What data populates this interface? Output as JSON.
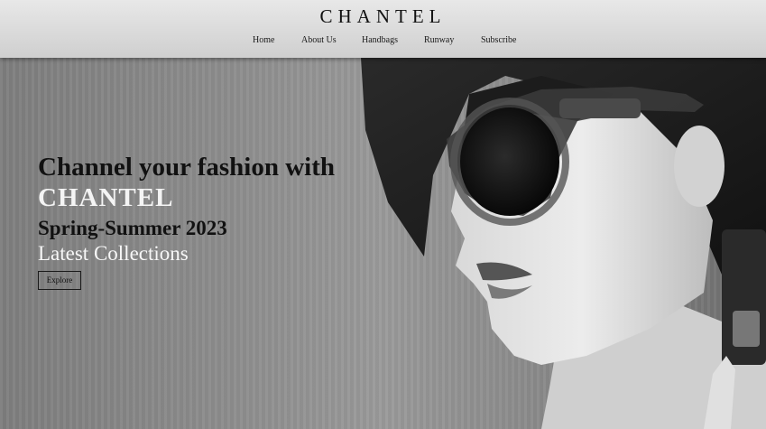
{
  "header": {
    "brand": "CHANTEL",
    "nav": [
      {
        "label": "Home"
      },
      {
        "label": "About Us"
      },
      {
        "label": "Handbags"
      },
      {
        "label": "Runway"
      },
      {
        "label": "Subscribe"
      }
    ]
  },
  "hero": {
    "headline": "Channel your fashion with",
    "brand": "CHANTEL",
    "season": "Spring-Summer 2023",
    "subtitle": "Latest Collections",
    "cta_label": "Explore"
  }
}
